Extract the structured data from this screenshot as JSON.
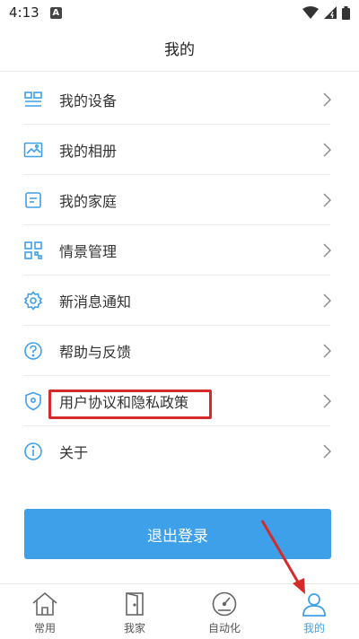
{
  "status_bar": {
    "time": "4:13",
    "notification": "A"
  },
  "header": {
    "title": "我的"
  },
  "menu": [
    {
      "label": "我的设备",
      "icon": "device-list-icon"
    },
    {
      "label": "我的相册",
      "icon": "album-icon"
    },
    {
      "label": "我的家庭",
      "icon": "family-icon"
    },
    {
      "label": "情景管理",
      "icon": "scene-grid-icon"
    },
    {
      "label": "新消息通知",
      "icon": "gear-icon"
    },
    {
      "label": "帮助与反馈",
      "icon": "help-icon"
    },
    {
      "label": "用户协议和隐私政策",
      "icon": "shield-icon"
    },
    {
      "label": "关于",
      "icon": "info-icon"
    }
  ],
  "logout_label": "退出登录",
  "tabs": [
    {
      "label": "常用",
      "icon": "home-icon"
    },
    {
      "label": "我家",
      "icon": "door-icon"
    },
    {
      "label": "自动化",
      "icon": "speedometer-icon"
    },
    {
      "label": "我的",
      "icon": "person-icon"
    }
  ],
  "colors": {
    "accent": "#3fa0ea",
    "annotation": "#d42a2a"
  }
}
